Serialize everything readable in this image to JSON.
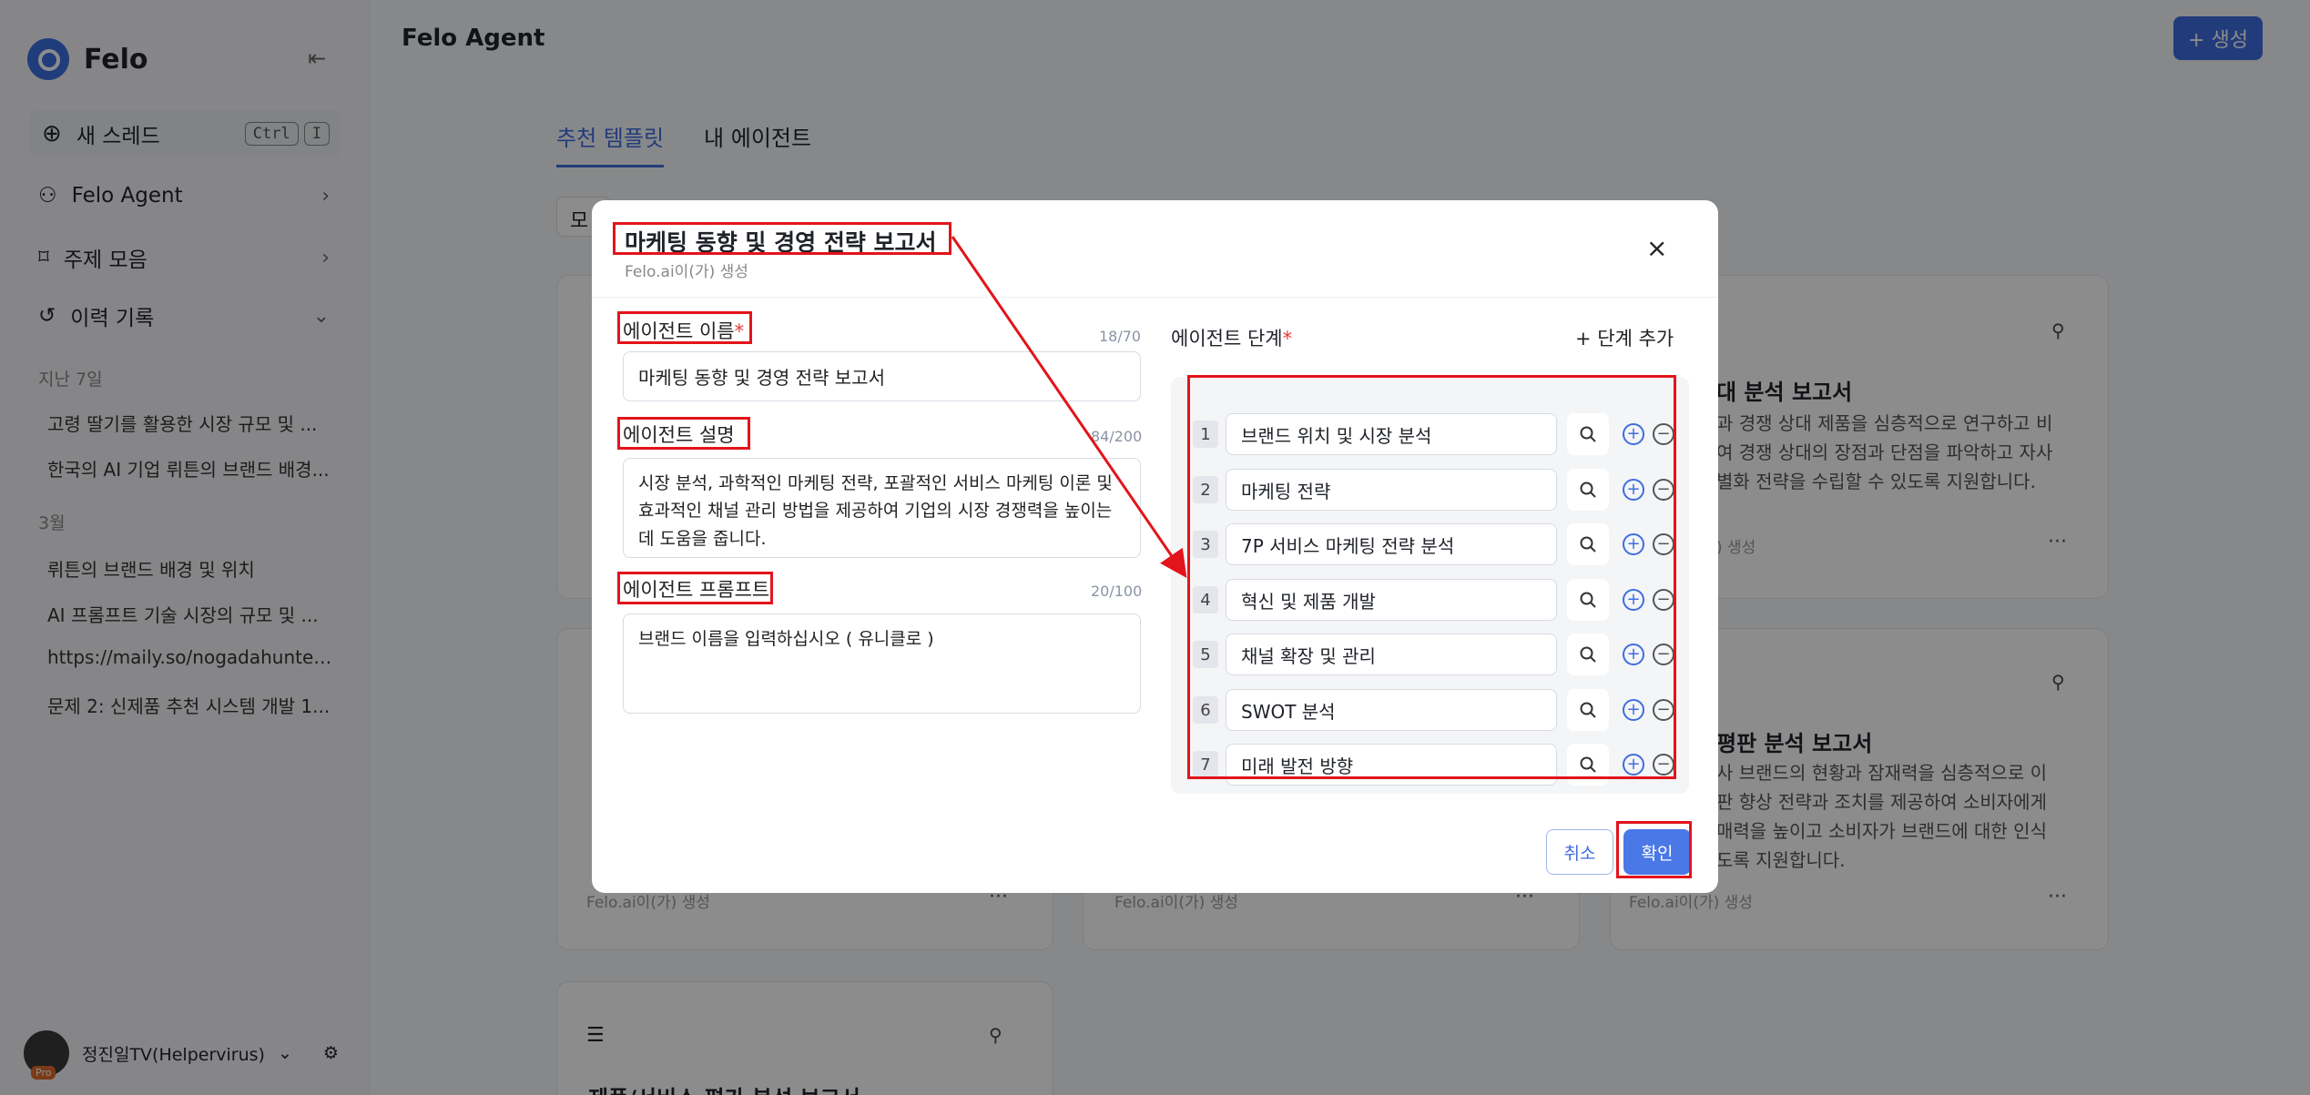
{
  "sidebar": {
    "brand": "Felo",
    "new_thread": "새 스레드",
    "kbd1": "Ctrl",
    "kbd2": "I",
    "nav": [
      {
        "label": "Felo Agent"
      },
      {
        "label": "주제 모음"
      },
      {
        "label": "이력 기록"
      }
    ],
    "groups": [
      {
        "label": "지난 7일",
        "items": [
          "고령 딸기를 활용한 시장 규모 및 ...",
          "한국의 AI 기업 뤼튼의 브랜드 배경..."
        ]
      },
      {
        "label": "3월",
        "items": [
          "뤼튼의 브랜드 배경 및 위치",
          "AI 프롬프트 기술 시장의 규모 및 ...",
          "https://maily.so/nogadahunter/pos...",
          "문제 2: 신제품 추천 시스템 개발 1..."
        ]
      }
    ],
    "user": "정진일TV(Helpervirus)",
    "pro_badge": "Pro"
  },
  "header": {
    "title": "Felo Agent",
    "create_button": "+ 생성"
  },
  "tabs": [
    {
      "label": "추천 템플릿",
      "active": true
    },
    {
      "label": "내 에이전트",
      "active": false
    }
  ],
  "filter_partial": "모",
  "cards": {
    "top_right": {
      "title": "대 분석 보고서",
      "desc": "과 경쟁 상대 제품을 심층적으로 연구하고 비\n여 경쟁 상대의 장점과 단점을 파악하고 자사\n별화 전략을 수립할 수 있도록 지원합니다.",
      "meta": ") 생성"
    },
    "mid_right": {
      "title": "평판 분석 보고서",
      "desc": "사 브랜드의 현황과 잠재력을 심층적으로 이\n판 향상 전략과 조치를 제공하여 소비자에게\n매력을 높이고 소비자가 브랜드에 대한 인식\n도록 지원합니다.",
      "meta": "Felo.ai이(가) 생성"
    },
    "mid_left": {
      "meta": "Felo.ai이(가) 생성"
    },
    "mid_center": {
      "meta": "Felo.ai이(가) 생성"
    },
    "bottom_left": {
      "title": "제품/서비스 평가 분석 보고서"
    },
    "more": "···"
  },
  "modal": {
    "title": "마케팅 동향 및 경영 전략 보고서",
    "subtitle": "Felo.ai이(가) 생성",
    "close": "×",
    "name_label": "에이전트 이름",
    "name_counter": "18/70",
    "name_value": "마케팅 동향 및 경영 전략 보고서",
    "desc_label": "에이전트 설명",
    "desc_counter": "84/200",
    "desc_value": "시장 분석, 과학적인 마케팅 전략, 포괄적인 서비스 마케팅 이론 및 효과적인 채널 관리 방법을 제공하여 기업의 시장 경쟁력을 높이는 데 도움을 줍니다.",
    "prompt_label": "에이전트 프롬프트",
    "prompt_counter": "20/100",
    "prompt_value": "브랜드 이름을 입력하십시오 ( 유니클로 )",
    "required_mark": "*",
    "steps_label": "에이전트 단계",
    "add_step": "+ 단계 추가",
    "steps": [
      {
        "num": "1",
        "text": "브랜드 위치 및 시장 분석"
      },
      {
        "num": "2",
        "text": "마케팅 전략"
      },
      {
        "num": "3",
        "text": "7P 서비스 마케팅 전략 분석"
      },
      {
        "num": "4",
        "text": "혁신 및 제품 개발"
      },
      {
        "num": "5",
        "text": "채널 확장 및 관리"
      },
      {
        "num": "6",
        "text": "SWOT 분석"
      },
      {
        "num": "7",
        "text": "미래 발전 방향"
      }
    ],
    "cancel": "취소",
    "confirm": "확인"
  },
  "colors": {
    "accent": "#3e6de0",
    "annotation": "#e3141b",
    "overlay": "rgba(0,0,0,0.45)"
  }
}
